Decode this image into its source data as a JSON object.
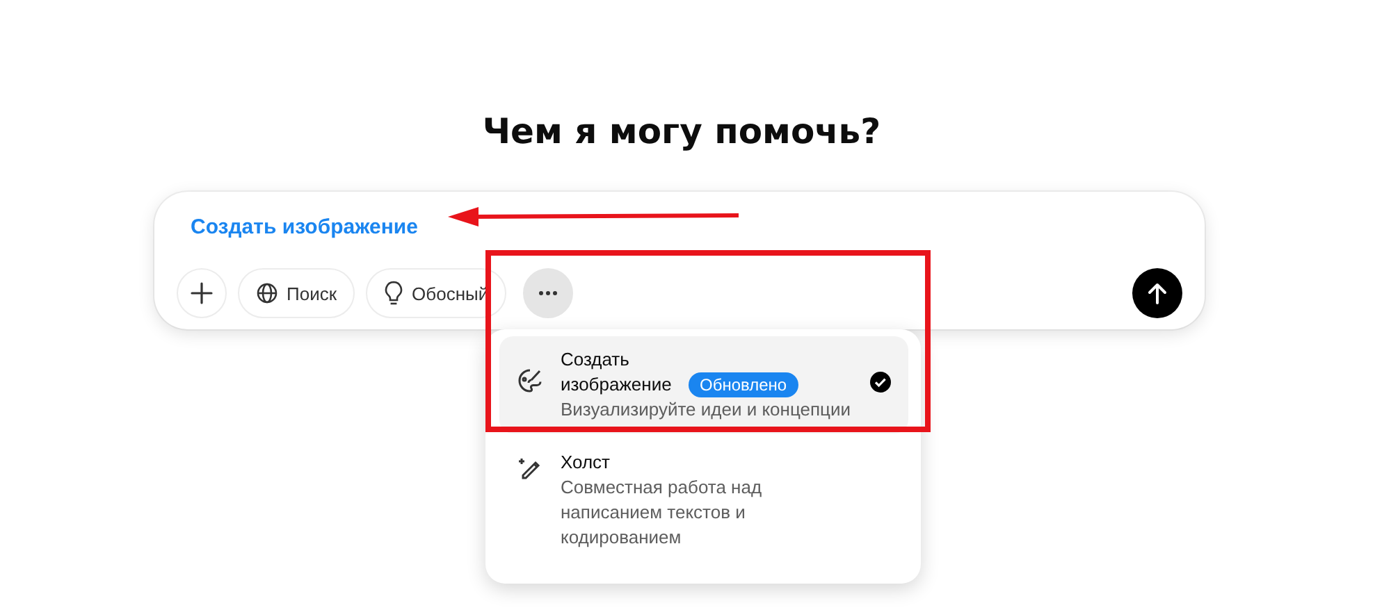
{
  "heading": "Чем я могу помочь?",
  "composer": {
    "tool_chip": "Создать изображение",
    "buttons": [
      {
        "kind": "plus"
      },
      {
        "kind": "search",
        "label": "Поиск"
      },
      {
        "kind": "think",
        "label": "Обосный"
      },
      {
        "kind": "more",
        "expanded": true
      }
    ]
  },
  "menu": {
    "items": [
      {
        "kind": "image",
        "title": "Создать изображение",
        "badge": "Обновлено",
        "description": "Визуализируйте идеи и концепции",
        "selected": true
      },
      {
        "kind": "canvas",
        "title": "Холст",
        "description": "Совместная работа над написанием текстов и кодированием",
        "selected": false
      }
    ]
  }
}
